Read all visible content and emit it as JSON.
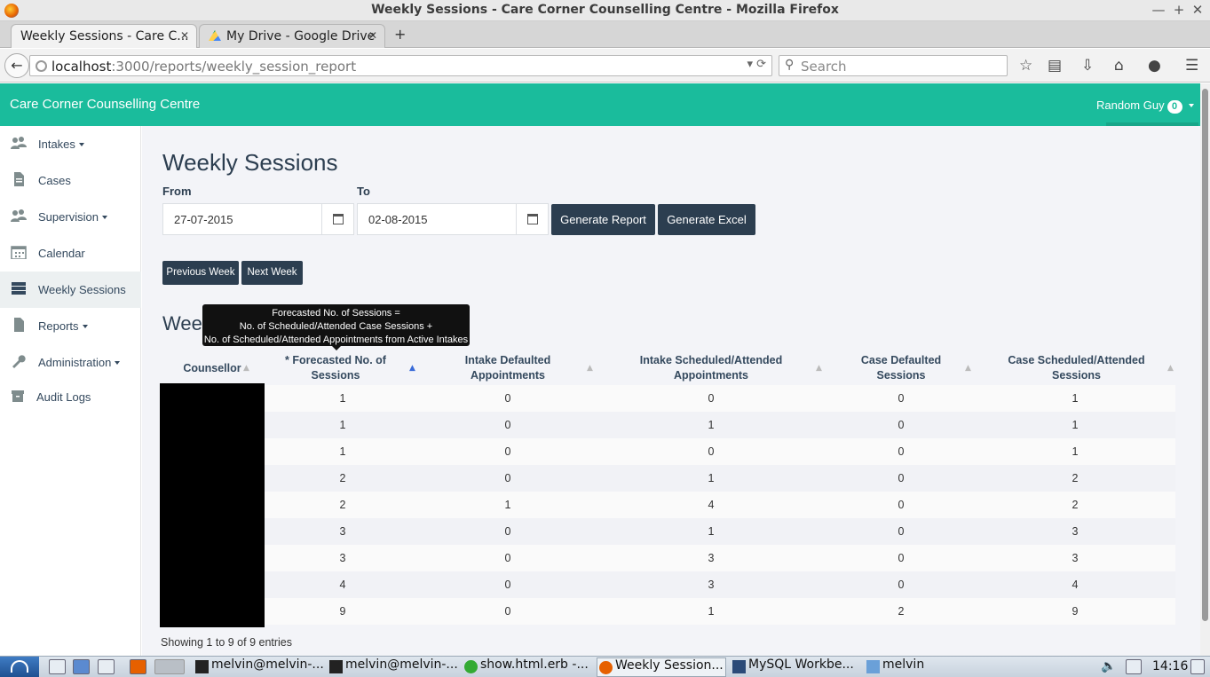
{
  "window": {
    "title": "Weekly Sessions - Care Corner Counselling Centre - Mozilla Firefox",
    "controls": [
      "—",
      "+",
      "✕"
    ]
  },
  "tabs": [
    {
      "label": "Weekly Sessions - Care C...",
      "close": "✕"
    },
    {
      "label": "My Drive - Google Drive",
      "close": "✕"
    }
  ],
  "new_tab": "+",
  "nav": {
    "url_host": "localhost",
    "url_path": ":3000/reports/weekly_session_report",
    "url_ctrls": "▾ ⟳",
    "search_placeholder": "Search"
  },
  "app": {
    "brand": "Care Corner Counselling Centre",
    "user": "Random Guy",
    "badge": "0"
  },
  "sidebar": [
    {
      "label": "Intakes",
      "dropdown": true
    },
    {
      "label": "Cases"
    },
    {
      "label": "Supervision",
      "dropdown": true
    },
    {
      "label": "Calendar"
    },
    {
      "label": "Weekly Sessions",
      "active": true
    },
    {
      "label": "Reports",
      "dropdown": true
    },
    {
      "label": "Administration",
      "dropdown": true
    },
    {
      "label": "Audit Logs"
    }
  ],
  "page": {
    "title": "Weekly Sessions",
    "from_label": "From",
    "to_label": "To",
    "from_value": "27-07-2015",
    "to_value": "02-08-2015",
    "generate_report": "Generate Report",
    "generate_excel": "Generate Excel",
    "prev_week": "Previous Week",
    "next_week": "Next Week",
    "section_title": "Weekly Sessions",
    "tooltip_lines": [
      "Forecasted No. of Sessions =",
      "No. of Scheduled/Attended Case Sessions +",
      "No. of Scheduled/Attended Appointments from Active Intakes"
    ]
  },
  "table": {
    "headers": [
      [
        "Counsellor"
      ],
      [
        "* Forecasted No. of",
        "Sessions"
      ],
      [
        "Intake Defaulted",
        "Appointments"
      ],
      [
        "Intake Scheduled/Attended",
        "Appointments"
      ],
      [
        "Case Defaulted",
        "Sessions"
      ],
      [
        "Case Scheduled/Attended",
        "Sessions"
      ]
    ],
    "rows": [
      [
        "1",
        "0",
        "0",
        "0",
        "1"
      ],
      [
        "1",
        "0",
        "1",
        "0",
        "1"
      ],
      [
        "1",
        "0",
        "0",
        "0",
        "1"
      ],
      [
        "2",
        "0",
        "1",
        "0",
        "2"
      ],
      [
        "2",
        "1",
        "4",
        "0",
        "2"
      ],
      [
        "3",
        "0",
        "1",
        "0",
        "3"
      ],
      [
        "3",
        "0",
        "3",
        "0",
        "3"
      ],
      [
        "4",
        "0",
        "3",
        "0",
        "4"
      ],
      [
        "9",
        "0",
        "1",
        "2",
        "9"
      ]
    ],
    "info": "Showing 1 to 9 of 9 entries"
  },
  "taskbar": {
    "tasks": [
      "melvin@melvin-...",
      "melvin@melvin-...",
      "show.html.erb -...",
      "Weekly Session...",
      "MySQL Workbe...",
      "melvin"
    ],
    "clock": "14:16"
  },
  "colors": {
    "header": "#1abc9c",
    "dark_button": "#2c3e50",
    "content_bg": "#f3f4f8"
  }
}
